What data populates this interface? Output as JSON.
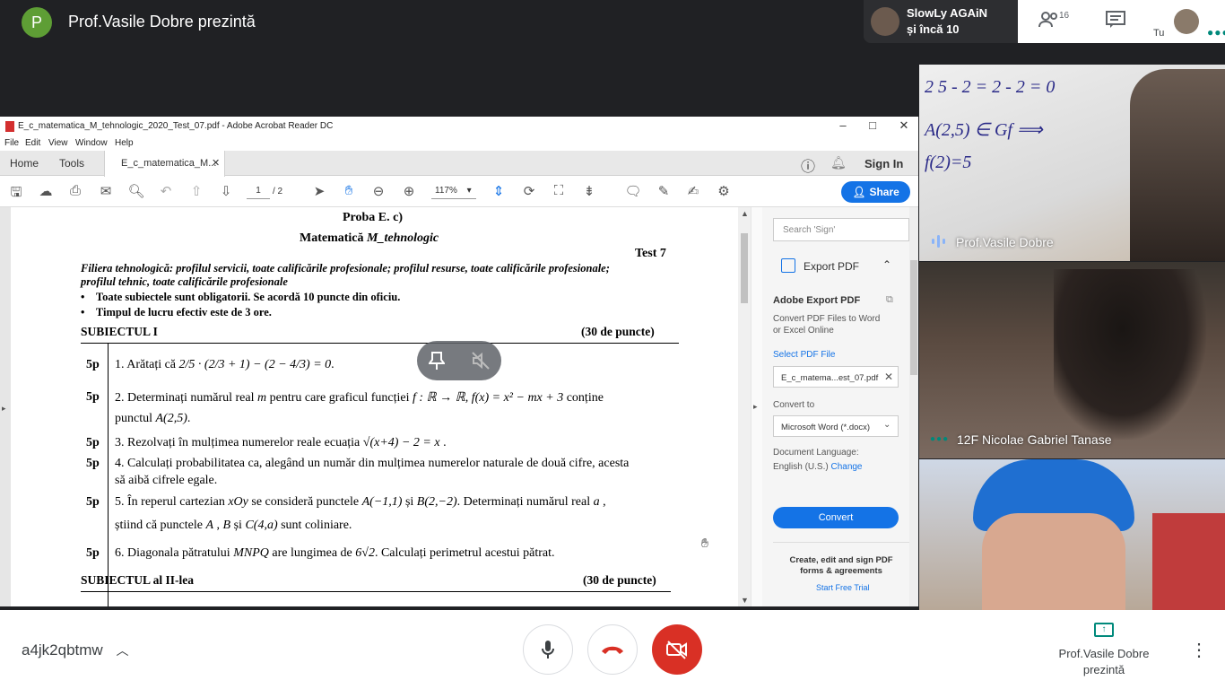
{
  "meet": {
    "presenter_initial": "P",
    "presenter_title": "Prof.Vasile Dobre prezintă",
    "participant_name": "SlowLy AGAiN",
    "participant_more": "și încă 10",
    "people_count": "16",
    "self_label": "Tu",
    "meeting_code": "a4jk2qbtmw",
    "present_label": "Prof.Vasile Dobre prezintă",
    "accent": "#00897b",
    "hangup_color": "#d93025"
  },
  "tiles": [
    {
      "name": "Prof.Vasile Dobre",
      "board_lines": [
        "2 5 - 2 = 2 - 2 = 0",
        "A(2,5) ∈ Gf ⟹",
        "f(2)=5"
      ]
    },
    {
      "name": "12F Nicolae Gabriel Tanase"
    },
    {
      "name": ""
    }
  ],
  "acrobat": {
    "window_title": "E_c_matematica_M_tehnologic_2020_Test_07.pdf - Adobe Acrobat Reader DC",
    "menu": [
      "File",
      "Edit",
      "View",
      "Window",
      "Help"
    ],
    "tabs": {
      "home": "Home",
      "tools": "Tools",
      "doc": "E_c_matematica_M...",
      "sign_in": "Sign In"
    },
    "page_current": "1",
    "page_total": "/ 2",
    "zoom": "117%",
    "share": "Share",
    "brand_color": "#1473e6"
  },
  "pane": {
    "search_placeholder": "Search 'Sign'",
    "export_pdf": "Export PDF",
    "adobe_export_pdf": "Adobe Export PDF",
    "convert_desc": "Convert PDF Files to Word or Excel Online",
    "select_pdf": "Select PDF File",
    "file_name": "E_c_matema...est_07.pdf",
    "convert_to": "Convert to",
    "format": "Microsoft Word (*.docx)",
    "doc_lang": "Document Language:",
    "lang_value": "English (U.S.)",
    "change": "Change",
    "convert_button": "Convert",
    "promo": "Create, edit and sign PDF forms & agreements",
    "trial": "Start Free Trial"
  },
  "doc": {
    "header1": "Proba E. c)",
    "header2_a": "Matematică ",
    "header2_b": "M_tehnologic",
    "test": "Test 7",
    "filiera1": "Filiera tehnologică: profilul servicii, toate calificările profesionale; profilul resurse, toate calificările profesionale;",
    "filiera2": "profilul tehnic, toate calificările profesionale",
    "bullet1": "Toate subiectele sunt obligatorii. Se acordă 10 puncte din oficiu.",
    "bullet2": "Timpul de lucru efectiv este de 3 ore.",
    "sub1": "SUBIECTUL I",
    "sub1_pts": "(30 de puncte)",
    "sub2": "SUBIECTUL al II-lea",
    "sub2_pts": "(30 de puncte)",
    "points": "5p",
    "q1": "1. Arătați că",
    "q2a": "2. Determinați numărul real",
    "q2b": "pentru care graficul funcției",
    "q2c": "conține",
    "q2d": "punctul",
    "q3": "3. Rezolvați în mulțimea numerelor reale ecuația",
    "q4a": "4. Calculați probabilitatea ca, alegând un număr din mulțimea numerelor naturale de două cifre, acesta",
    "q4b": "să aibă cifrele egale.",
    "q5a": "5. În reperul cartezian",
    "q5b": "se consideră punctele",
    "q5c": "și",
    "q5d": ". Determinați numărul real",
    "q5e": "știind că punctele",
    "q5f": "sunt coliniare.",
    "q6a": "6. Diagonala pătratului",
    "q6b": "are lungimea de",
    "q6c": ". Calculați perimetrul acestui pătrat."
  }
}
